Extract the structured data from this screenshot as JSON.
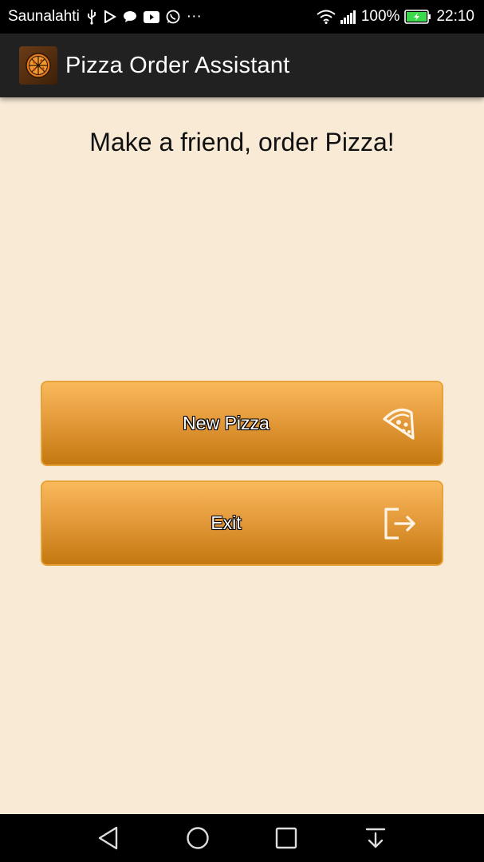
{
  "status_bar": {
    "carrier": "Saunalahti",
    "more": "···",
    "battery_percent": "100%",
    "time": "22:10",
    "icons": [
      "usb-icon",
      "play-store-icon",
      "chat-icon",
      "youtube-icon",
      "whatsapp-icon",
      "wifi-icon",
      "signal-icon",
      "battery-charging-icon"
    ],
    "battery_color": "#3ad94b"
  },
  "app_bar": {
    "title": "Pizza Order Assistant",
    "logo_icon": "pizza-logo-icon"
  },
  "main": {
    "headline": "Make a friend, order Pizza!",
    "buttons": [
      {
        "label": "New Pizza",
        "icon": "pizza-slice-icon"
      },
      {
        "label": "Exit",
        "icon": "exit-icon"
      }
    ]
  },
  "nav_bar": {
    "icons": [
      "back-icon",
      "home-icon",
      "recents-icon",
      "notifications-pull-icon"
    ]
  },
  "colors": {
    "background": "#f9ead6",
    "button_top": "#f9b95b",
    "button_bottom": "#c4780f",
    "button_border": "#e8a23a",
    "app_bar": "#212121"
  }
}
